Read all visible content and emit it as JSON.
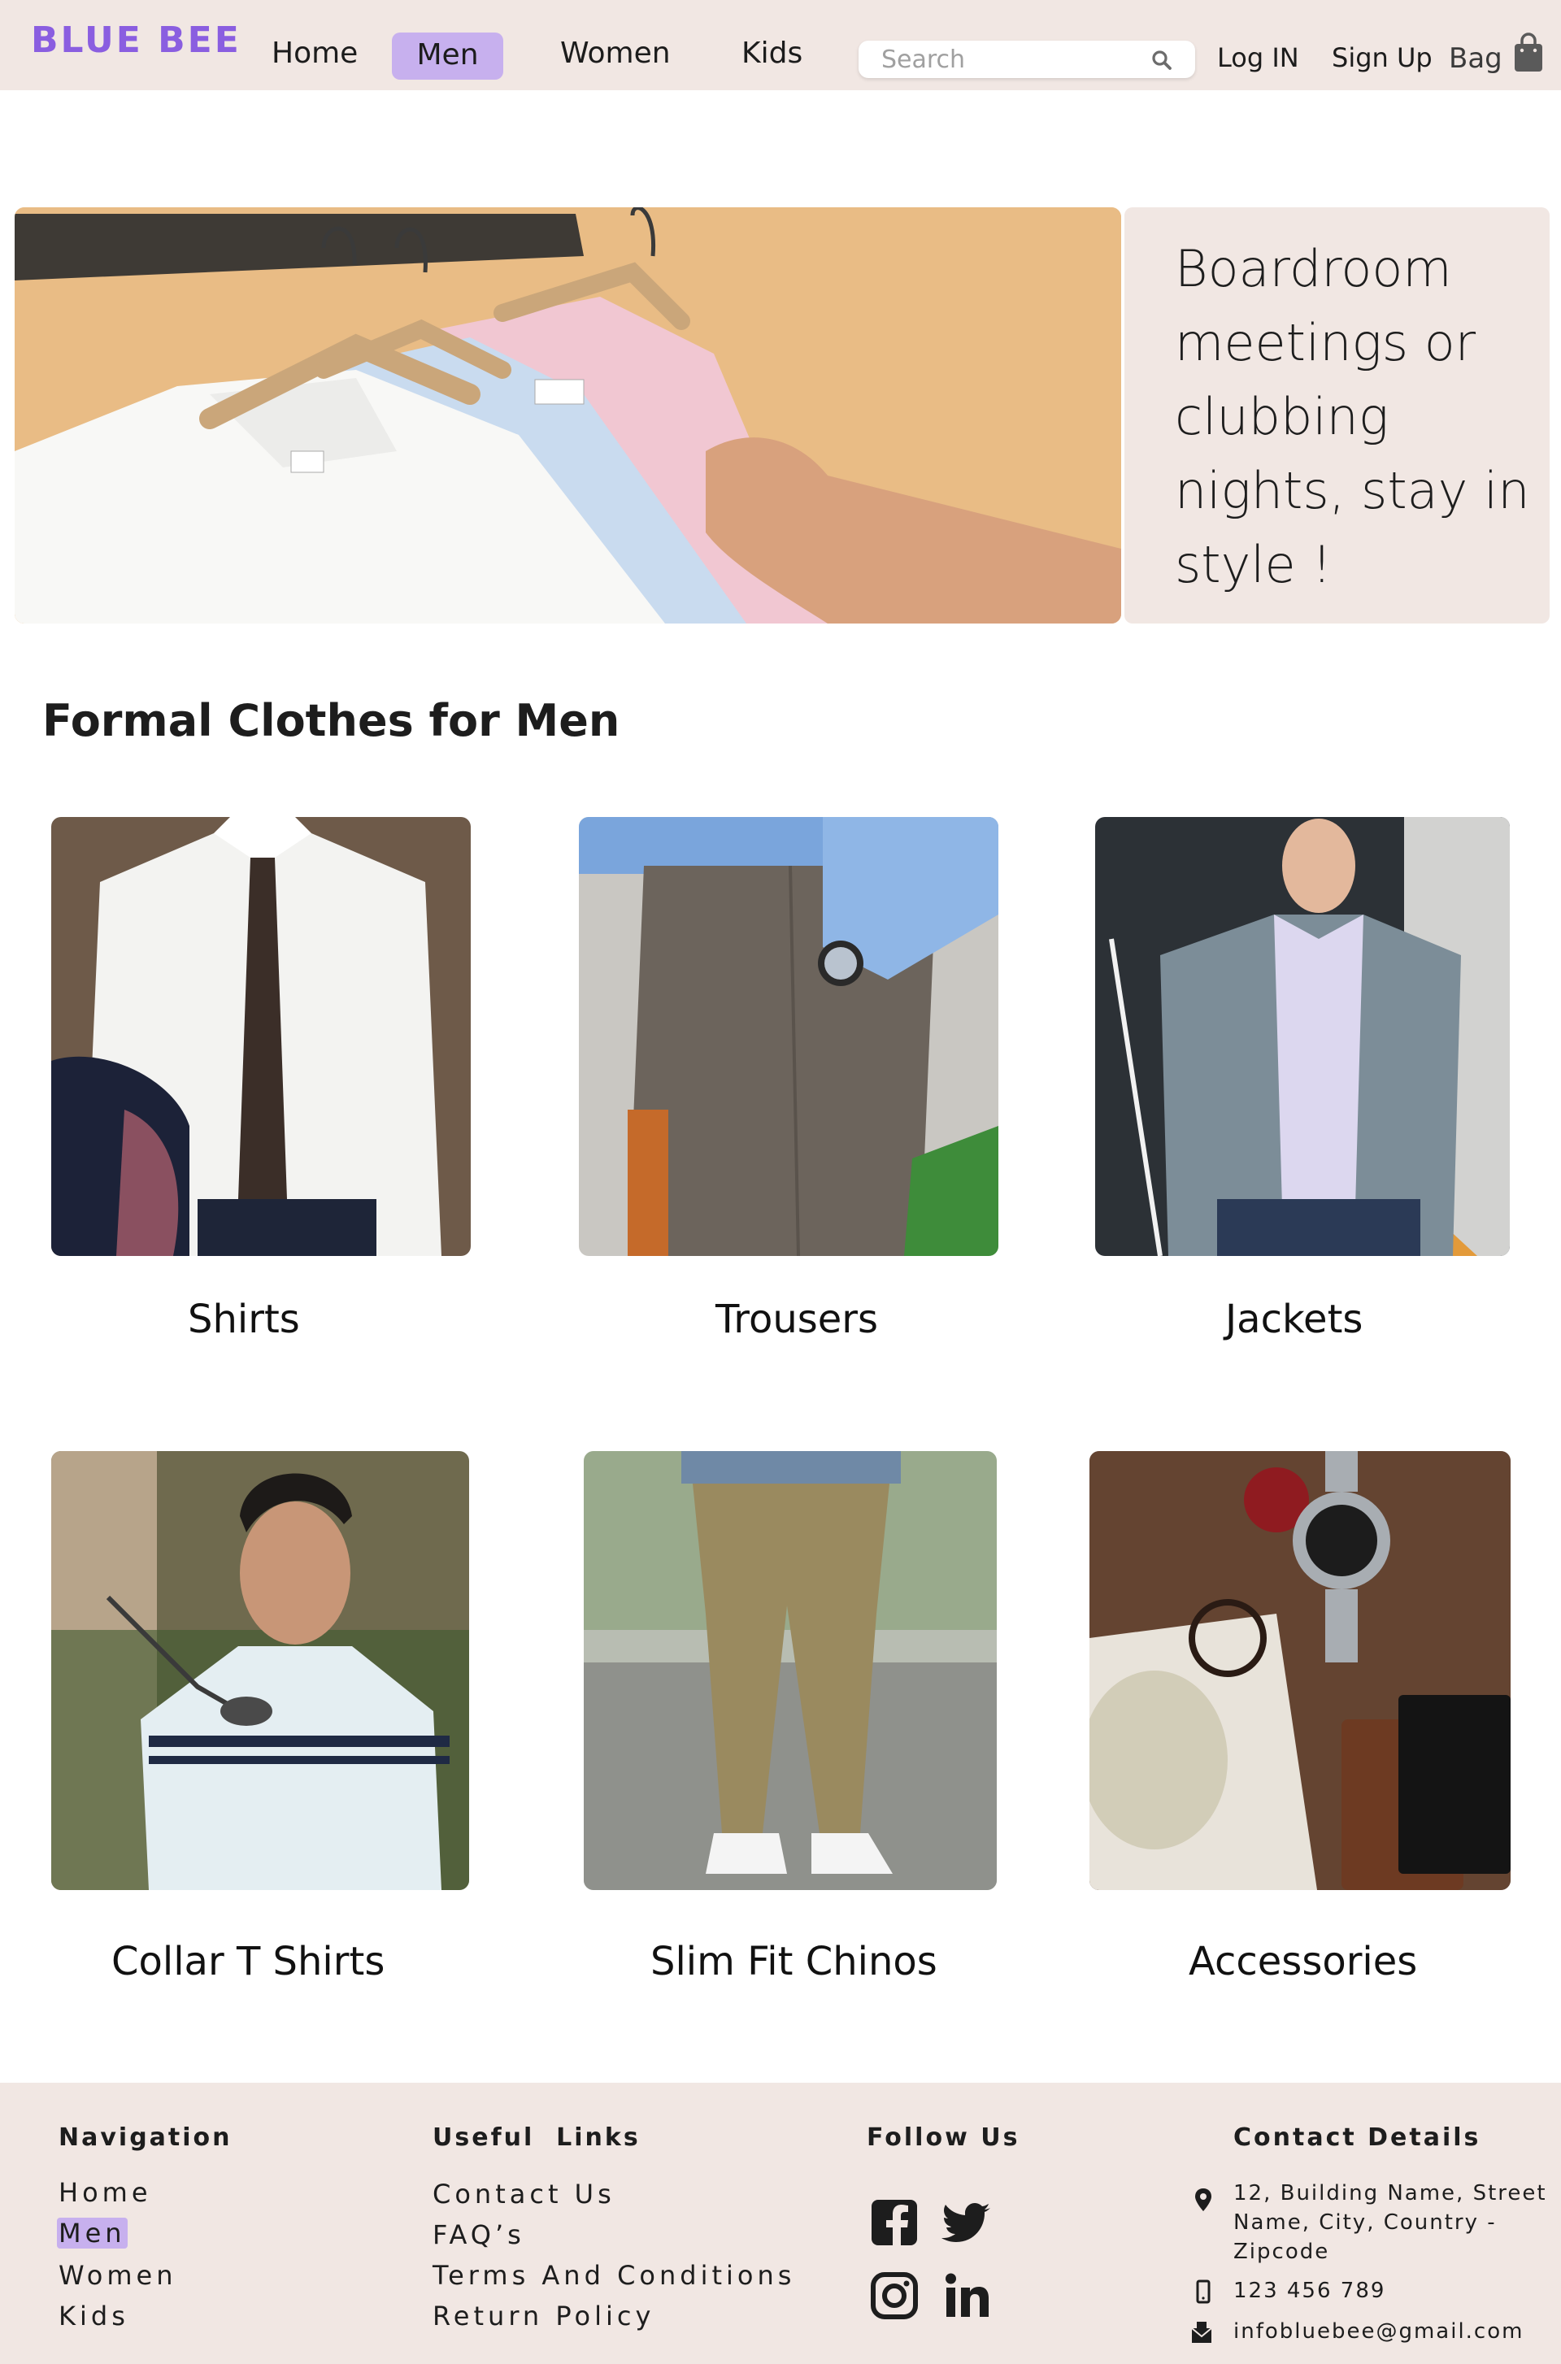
{
  "brand": {
    "name": "BLUE BEE",
    "accent": "#8a5ee0",
    "highlight": "#c7b0ee",
    "panel_bg": "#f1e7e3"
  },
  "nav": {
    "items": [
      {
        "label": "Home"
      },
      {
        "label": "Men",
        "active": true
      },
      {
        "label": "Women"
      },
      {
        "label": "Kids"
      }
    ],
    "search": {
      "placeholder": "Search",
      "value": "",
      "icon": "search-icon"
    },
    "login_label": "Log IN",
    "signup_label": "Sign Up",
    "bag_label": "Bag",
    "bag_icon": "shopping-bag-icon"
  },
  "hero": {
    "text": "Boardroom meetings or clubbing nights, stay in style !"
  },
  "section": {
    "title": "Formal Clothes for Men",
    "categories": [
      {
        "label": "Shirts"
      },
      {
        "label": "Trousers"
      },
      {
        "label": "Jackets"
      },
      {
        "label": "Collar T Shirts"
      },
      {
        "label": "Slim Fit Chinos"
      },
      {
        "label": "Accessories"
      }
    ]
  },
  "footer": {
    "navigation": {
      "heading": "Navigation",
      "links": [
        "Home",
        "Men",
        "Women",
        "Kids"
      ],
      "active": "Men"
    },
    "useful_links": {
      "heading": "Useful  Links",
      "links": [
        "Contact Us",
        "FAQ’s",
        "Terms And Conditions",
        "Return Policy"
      ]
    },
    "follow": {
      "heading": "Follow Us",
      "icons": [
        "facebook-icon",
        "twitter-icon",
        "instagram-icon",
        "linkedin-icon"
      ]
    },
    "contact": {
      "heading": "Contact Details",
      "address_lines": [
        "12, Building Name, Street",
        "Name, City, Country -",
        "Zipcode"
      ],
      "phone": "123 456 789",
      "email": "infobluebee@gmail.com"
    }
  }
}
